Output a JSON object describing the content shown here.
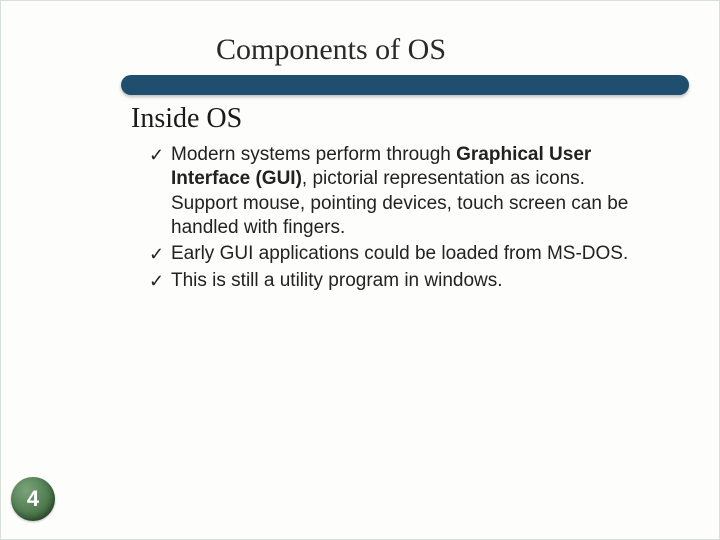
{
  "title": "Components of OS",
  "subtitle": "Inside OS",
  "bullets": [
    {
      "pre": "Modern systems perform through ",
      "bold": "Graphical User Interface (GUI)",
      "post": ", pictorial representation as icons. Support mouse, pointing devices, touch screen can be handled with fingers."
    },
    {
      "pre": " Early GUI applications could be loaded from MS-DOS.",
      "bold": "",
      "post": ""
    },
    {
      "pre": "This is still a utility program in windows.",
      "bold": "",
      "post": ""
    }
  ],
  "checkmark": "✓",
  "pageNumber": "4"
}
